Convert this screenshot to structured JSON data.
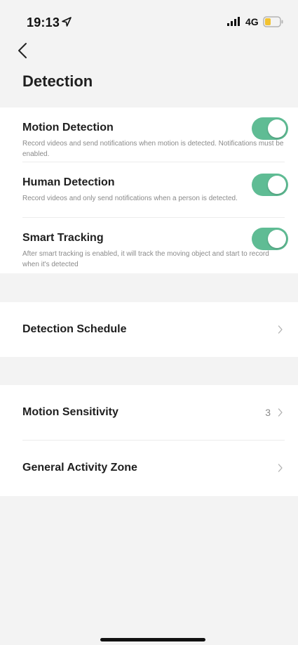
{
  "status_bar": {
    "time": "19:13",
    "network": "4G",
    "icons": [
      "location-icon",
      "signal-icon",
      "battery-icon"
    ],
    "battery_color": "#f2c230"
  },
  "nav": {
    "back_icon": "chevron-left-icon",
    "title": "Detection"
  },
  "toggles": [
    {
      "title": "Motion Detection",
      "description": "Record videos and send notifications when motion is detected. Notifications must be enabled.",
      "enabled": true
    },
    {
      "title": "Human Detection",
      "description": "Record videos and only send notifications when a person is detected.",
      "enabled": true
    },
    {
      "title": "Smart Tracking",
      "description": "After smart tracking is enabled, it will track the moving object and start to record when it's detected",
      "enabled": true
    }
  ],
  "schedule": {
    "label": "Detection Schedule"
  },
  "motion": {
    "sensitivity_label": "Motion Sensitivity",
    "sensitivity_value": "3",
    "zone_label": "General Activity Zone"
  },
  "colors": {
    "toggle_on": "#5fbc94",
    "background": "#f3f3f3",
    "card": "#ffffff"
  }
}
